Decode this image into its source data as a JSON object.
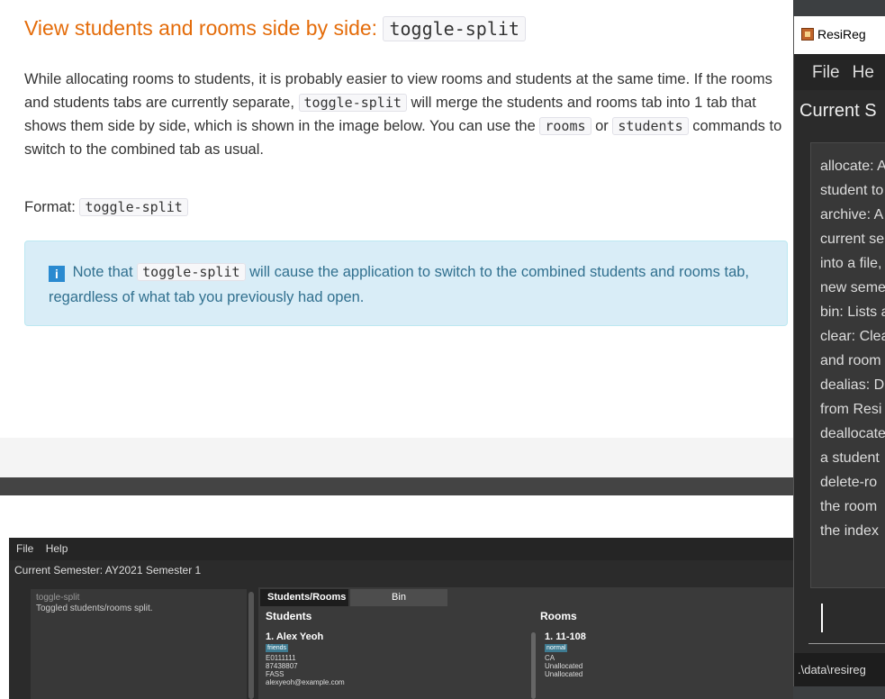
{
  "doc": {
    "heading_text": "View students and rooms side by side:",
    "heading_code": "toggle-split",
    "para_1": "While allocating rooms to students, it is probably easier to view rooms and students at the same time. If the rooms and students tabs are currently separate,",
    "para_code_1": "toggle-split",
    "para_2": "will merge the students and rooms tab into 1 tab that shows them side by side, which is shown in the image below. You can use the",
    "para_code_2": "rooms",
    "para_3": "or",
    "para_code_3": "students",
    "para_4": "commands to switch to the combined tab as usual.",
    "format_label": "Format:",
    "format_code": "toggle-split",
    "note_1": "Note that",
    "note_code": "toggle-split",
    "note_2": "will cause the application to switch to the combined students and rooms tab, regardless of what tab you previously had open.",
    "info_icon": "i"
  },
  "screenshot": {
    "menu": [
      "File",
      "Help"
    ],
    "semester": "Current Semester: AY2021 Semester 1",
    "result_cmd": "toggle-split",
    "result_msg": "Toggled students/rooms split.",
    "tabs": [
      "Students/Rooms",
      "Bin"
    ],
    "students_heading": "Students",
    "rooms_heading": "Rooms",
    "student": {
      "name": "1.  Alex Yeoh",
      "tag": "friends",
      "lines": [
        "E0111111",
        "87438807",
        "FASS",
        "alexyeoh@example.com"
      ]
    },
    "room": {
      "name": "1.  11-108",
      "tag": "normal",
      "lines": [
        "CA",
        "Unallocated",
        "Unallocated"
      ]
    }
  },
  "resireg": {
    "title": "ResiReg",
    "menu": [
      "File",
      "He"
    ],
    "semester": "Current S",
    "help_lines": [
      "allocate: A",
      "student to",
      "archive: A",
      "current se",
      "into a file,",
      "new seme",
      "bin: Lists a",
      "clear: Clea",
      "and room",
      "dealias: D",
      "from Resi",
      "deallocate",
      "a student",
      "delete-ro",
      "the room",
      "the index"
    ],
    "status": ".\\data\\resireg"
  }
}
